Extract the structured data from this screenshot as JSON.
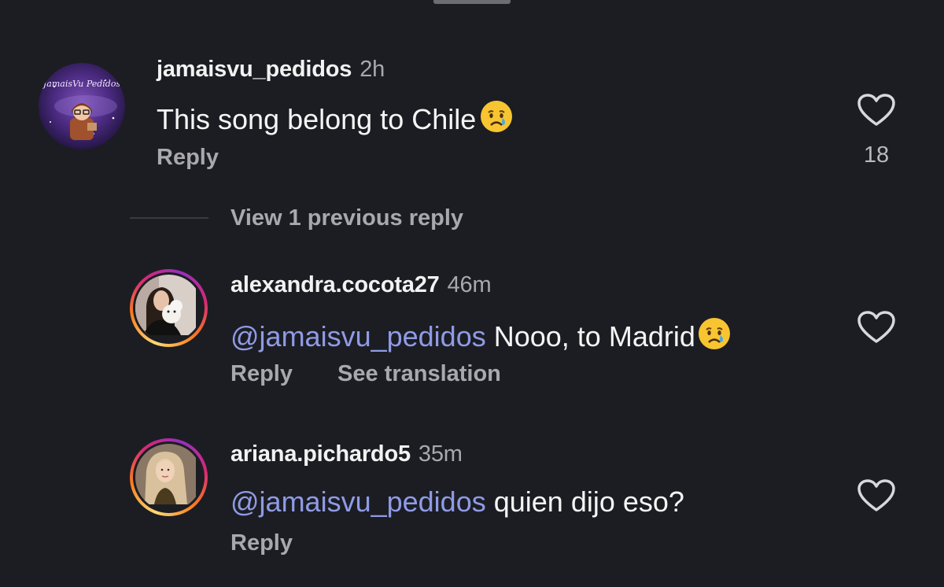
{
  "comments": [
    {
      "username": "jamaisvu_pedidos",
      "time": "2h",
      "text": "This song belong to Chile",
      "emoji": "crying-face",
      "reply_label": "Reply",
      "likes": "18",
      "avatar_text": "JamaisVu Pedidos"
    }
  ],
  "view_replies": "View 1 previous reply",
  "replies": [
    {
      "username": "alexandra.cocota27",
      "time": "46m",
      "mention": "@jamaisvu_pedidos",
      "text": " Nooo, to Madrid",
      "emoji": "crying-face",
      "reply_label": "Reply",
      "translate_label": "See translation"
    },
    {
      "username": "ariana.pichardo5",
      "time": "35m",
      "mention": "@jamaisvu_pedidos",
      "text": " quien dijo eso?",
      "reply_label": "Reply"
    }
  ],
  "colors": {
    "background": "#1c1d22",
    "mention": "#8f9be6",
    "muted": "#a8a8ad",
    "story_ring": [
      "#feda75",
      "#fa7e1e",
      "#d62976",
      "#962fbf"
    ]
  }
}
